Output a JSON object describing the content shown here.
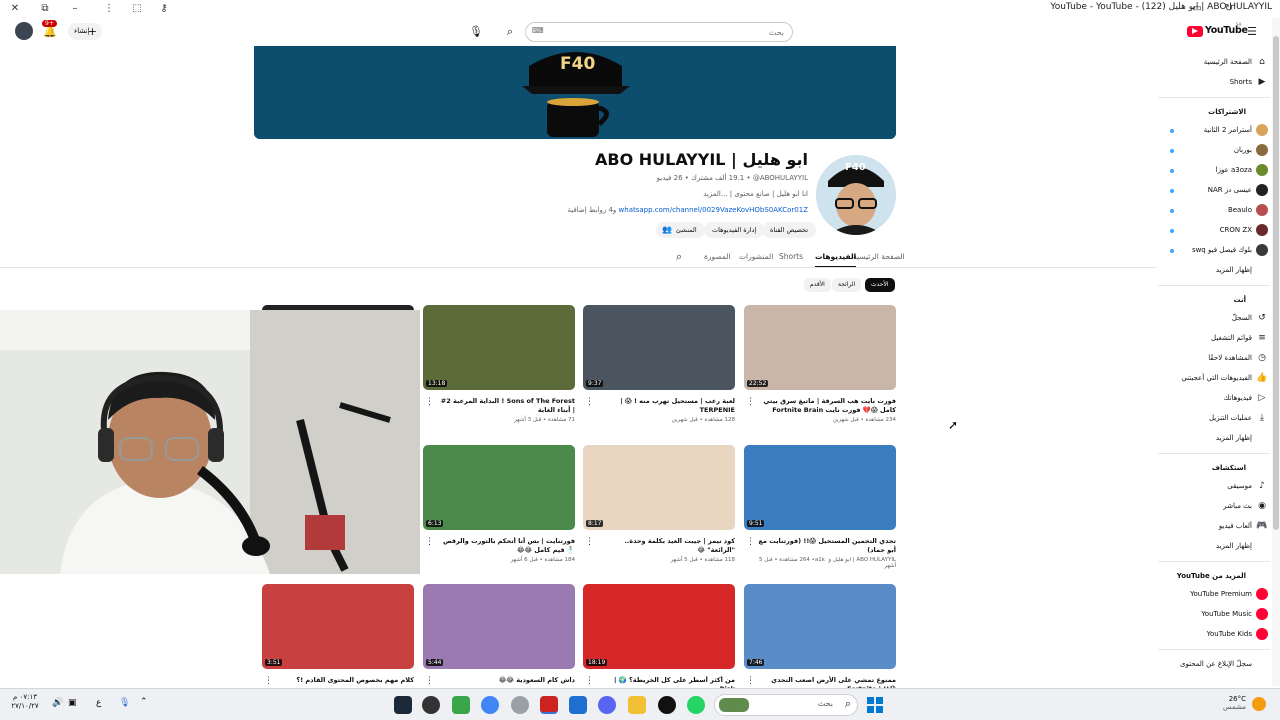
{
  "window": {
    "title": "ABO HULAYYIL | ابو هليل (122) - YouTube - YouTube"
  },
  "masthead": {
    "logo_text": "YouTube",
    "logo_sup": "SA",
    "search_placeholder": "بحث",
    "create_label": "إنشاء",
    "notif_count": "9+"
  },
  "sidebar": {
    "main": [
      {
        "label": "الصفحة الرئيسية",
        "icon": "home-icon"
      },
      {
        "label": "Shorts",
        "icon": "shorts-icon"
      }
    ],
    "subs_heading": "الاشتراكات",
    "subs": [
      {
        "label": "أسترامر 2 الثانية",
        "color": "#d9a35b"
      },
      {
        "label": "بوربان",
        "color": "#8a6a3f"
      },
      {
        "label": "a3oza عوزا",
        "color": "#6a8a2c"
      },
      {
        "label": "عيسى دز NAR",
        "color": "#222222"
      },
      {
        "label": "Beaulo",
        "color": "#b65050"
      },
      {
        "label": "CRON ZX",
        "color": "#6a2a2a"
      },
      {
        "label": "بلوك فيصل فيو swq",
        "color": "#3a3a3a"
      }
    ],
    "subs_more": "إظهار المزيد",
    "you_heading": "أنت",
    "you": [
      {
        "label": "السجلّ",
        "icon": "history-icon"
      },
      {
        "label": "قوائم التشغيل",
        "icon": "playlist-icon"
      },
      {
        "label": "المشاهدة لاحقًا",
        "icon": "clock-icon"
      },
      {
        "label": "الفيديوهات التي أعجبتني",
        "icon": "thumbs-up-icon"
      },
      {
        "label": "فيديوهاتك",
        "icon": "your-videos-icon"
      },
      {
        "label": "عمليات التنزيل",
        "icon": "download-icon"
      }
    ],
    "you_more": "إظهار المزيد",
    "explore_heading": "استكشاف",
    "explore": [
      {
        "label": "موسيقى",
        "icon": "music-icon"
      },
      {
        "label": "بث مباشر",
        "icon": "live-icon"
      },
      {
        "label": "ألعاب فيديو",
        "icon": "gaming-icon"
      }
    ],
    "explore_more": "إظهار المزيد",
    "more_yt_heading": "المزيد من YouTube",
    "more_yt": [
      {
        "label": "YouTube Premium",
        "color": "#ff0033"
      },
      {
        "label": "YouTube Music",
        "color": "#ff0033"
      },
      {
        "label": "YouTube Kids",
        "color": "#ff0033"
      }
    ],
    "report_label": "سجلّ الإبلاغ عن المحتوى"
  },
  "channel": {
    "banner_logo": "F40",
    "avatar_text": "F40",
    "name": "ABO HULAYYIL | ابو هليل",
    "stats": "‎@ABOHULAYYIL‏ • ‏19.1 ألف مشترك • 26 فيديو",
    "about": "انا ابو هليل | صانع محتوى | ...المزيد",
    "link": "whatsapp.com/channel/0029VazeKovHObS0AKCor01Z",
    "link_more": "و4 روابط إضافية",
    "buttons": [
      "تخصيص القناة",
      "إدارة الفيديوهات",
      "المنشئ"
    ]
  },
  "tabs": [
    "الصفحة الرئيسية",
    "الفيديوهات",
    "Shorts",
    "المنشورات",
    "المصورة"
  ],
  "filters": [
    "الأحدث",
    "الرائجة",
    "الأقدم"
  ],
  "videos": [
    {
      "title": "فورت نايت هب السرقة | ماتبغ سرق بيتي كامل 😱💔 فورت نايت Fortnite Brain",
      "meta": "234 مشاهدة • قبل شهرين",
      "duration": "22:52",
      "bg": "#c9b6a8"
    },
    {
      "title": "لعبة رعب | مستحيل تهرب منه ! 😱 | TERPENIE",
      "meta": "128 مشاهدة • قبل شهرين",
      "duration": "9:37",
      "bg": "#4a5560"
    },
    {
      "title": "Sons of The Forest ! البداية المرعبة 2# | أبناء الغابة",
      "meta": "71 مشاهدة • قبل 3 أشهر",
      "duration": "13:18",
      "bg": "#5c6b3a"
    },
    {
      "title": "",
      "meta": "",
      "duration": "",
      "bg": "#222222"
    },
    {
      "title": "تحدي التخمين المستحيل 😱!! (فورتنايت مع أبو حماد)",
      "meta": "ABO HULAYYIL | ابو هليل و a1k ‎• ‏264 مشاهدة • قبل 5 أشهر",
      "duration": "9:51",
      "bg": "#3a7ec0"
    },
    {
      "title": "كود نيمز | جيبت العيد بكلمة وحدة.. \"الرائعة\" 😂",
      "meta": "118 مشاهدة • قبل 5 أشهر",
      "duration": "8:17",
      "bg": "#e8d6c0"
    },
    {
      "title": "فورتنايت | بس أنا أتحكم بالتورت والرقص 🕺 قيم كامل 😂😂",
      "meta": "184 مشاهدة • قبل 6 أشهر",
      "duration": "6:13",
      "bg": "#4b8a4a"
    },
    {
      "title": "",
      "meta": "",
      "duration": "",
      "bg": "#eeeeee"
    },
    {
      "title": "ممنوع تمشي على الأرض اصعب التحدي 😱!! | Fortnite",
      "meta": "",
      "duration": "7:46",
      "bg": "#5a8cc8"
    },
    {
      "title": "من أكثر أسطر على كل الخريطة؟ 🌍 | Risk",
      "meta": "",
      "duration": "18:19",
      "bg": "#d62828"
    },
    {
      "title": "داش كام السعودية 😂😂",
      "meta": "",
      "duration": "5:44",
      "bg": "#9a7ab0"
    },
    {
      "title": "كلام مهم بخصوص المحتوى القادم !؟",
      "meta": "",
      "duration": "3:51",
      "bg": "#c84040"
    }
  ],
  "taskbar": {
    "search_placeholder": "بحث",
    "time": "٠٧:١٣ م",
    "date": "٢٧/١٠/٢٧",
    "weather_temp": "26°C",
    "weather_desc": "مشمس",
    "lang": "ع"
  }
}
